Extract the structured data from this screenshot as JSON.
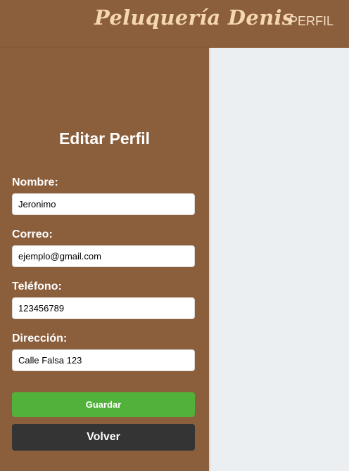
{
  "header": {
    "brand": "Peluquería Denis",
    "nav_profile": "PERFIL"
  },
  "form": {
    "title": "Editar Perfil",
    "fields": [
      {
        "label": "Nombre:",
        "value": "Jeronimo"
      },
      {
        "label": "Correo:",
        "value": "ejemplo@gmail.com"
      },
      {
        "label": "Teléfono:",
        "value": "123456789"
      },
      {
        "label": "Dirección:",
        "value": "Calle Falsa 123"
      }
    ],
    "save_label": "Guardar",
    "back_label": "Volver"
  },
  "colors": {
    "brown": "#8b5e3c",
    "save_green": "#52b13a",
    "back_dark": "#343434",
    "background": "#ebeff1"
  }
}
